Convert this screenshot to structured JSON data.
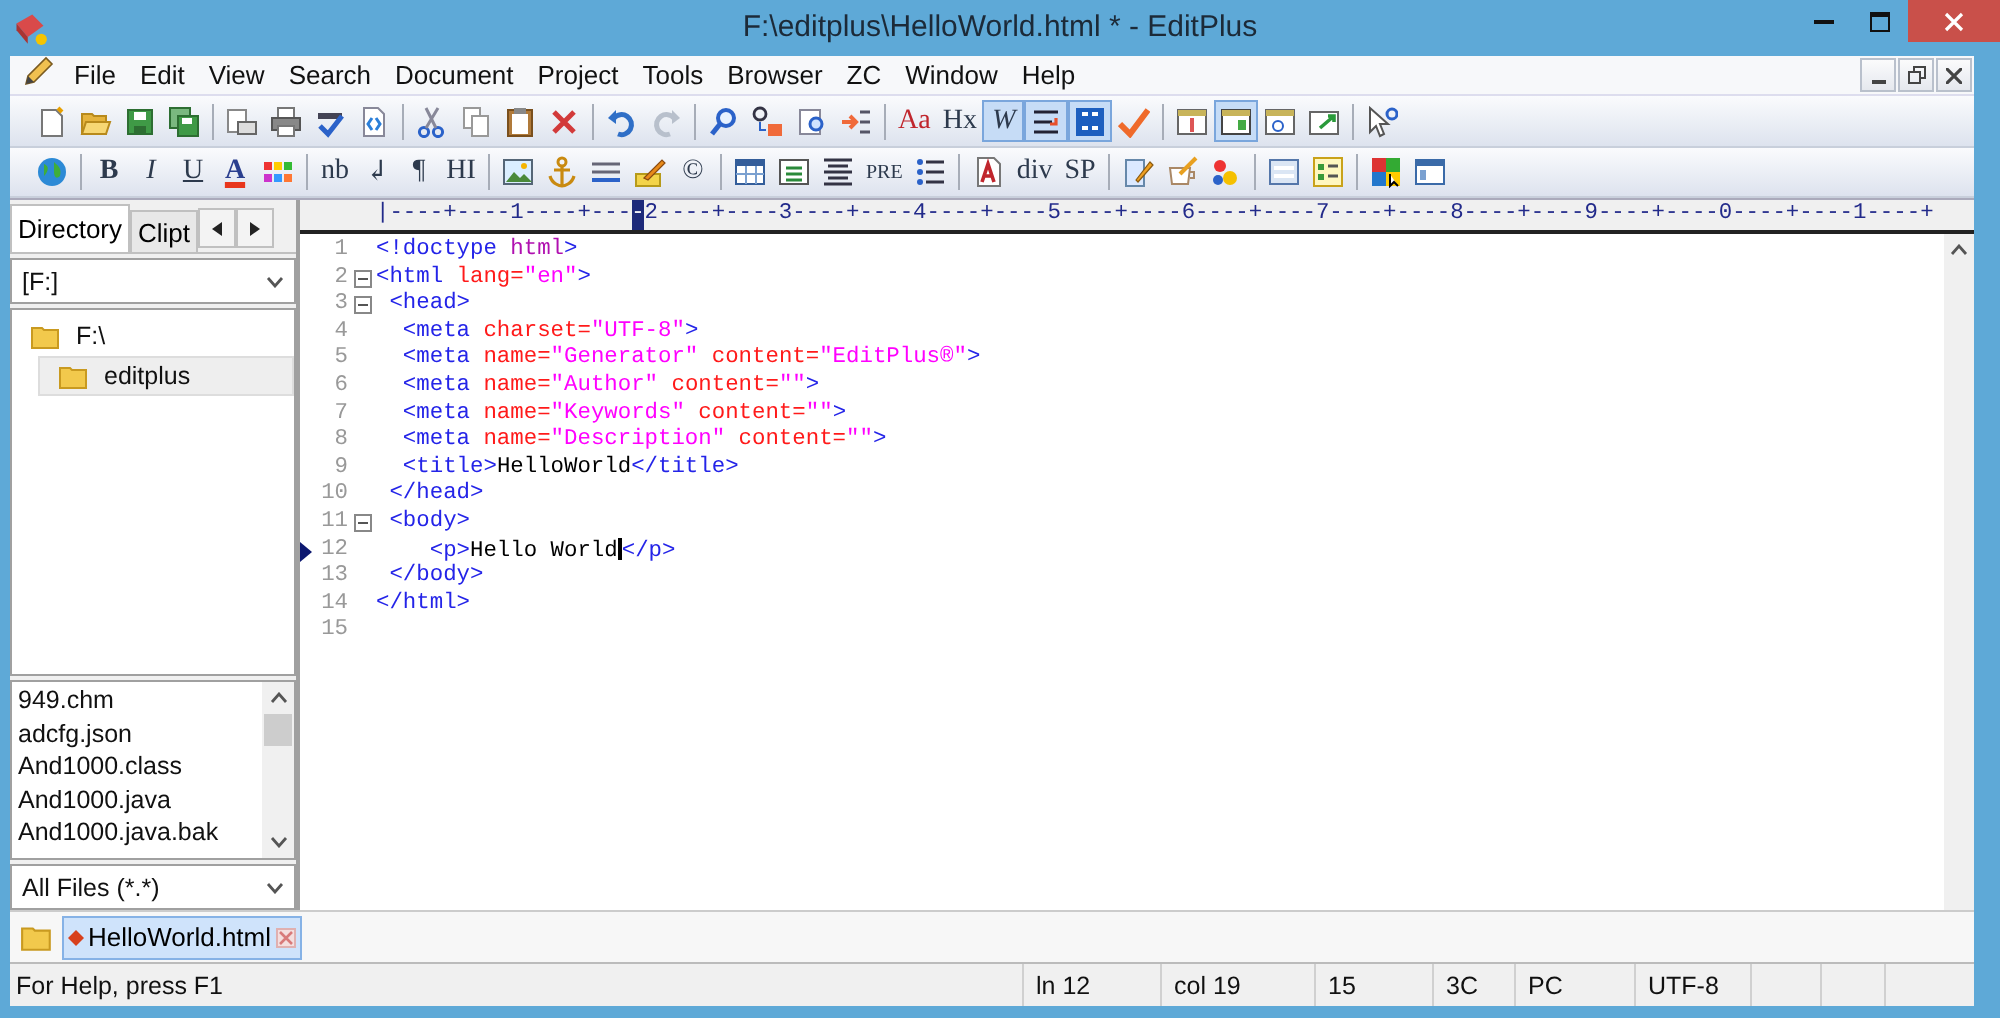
{
  "window": {
    "title": "F:\\editplus\\HelloWorld.html * - EditPlus"
  },
  "menu": [
    "File",
    "Edit",
    "View",
    "Search",
    "Document",
    "Project",
    "Tools",
    "Browser",
    "ZC",
    "Window",
    "Help"
  ],
  "toolbar_1": [
    {
      "kind": "icon",
      "on": false
    },
    {
      "kind": "icon",
      "on": false
    },
    {
      "kind": "icon",
      "on": false
    },
    {
      "kind": "icon",
      "on": false
    },
    {
      "kind": "separator"
    },
    {
      "kind": "icon",
      "on": false
    },
    {
      "kind": "icon",
      "on": false
    },
    {
      "kind": "icon",
      "on": false
    },
    {
      "kind": "icon",
      "on": false
    },
    {
      "kind": "separator"
    },
    {
      "kind": "icon",
      "on": false
    },
    {
      "kind": "icon",
      "on": false
    },
    {
      "kind": "icon",
      "on": false
    },
    {
      "kind": "icon",
      "on": false
    },
    {
      "kind": "separator"
    },
    {
      "kind": "icon",
      "on": false
    },
    {
      "kind": "icon",
      "on": false
    },
    {
      "kind": "separator"
    },
    {
      "kind": "icon",
      "on": false
    },
    {
      "kind": "icon",
      "on": false
    },
    {
      "kind": "icon",
      "on": false
    },
    {
      "kind": "icon",
      "on": false
    },
    {
      "kind": "separator"
    },
    {
      "kind": "text",
      "label": "Aa",
      "on": false
    },
    {
      "kind": "text",
      "label": "Hx",
      "on": false
    },
    {
      "kind": "text",
      "label": "W",
      "on": true
    },
    {
      "kind": "icon",
      "on": true
    },
    {
      "kind": "icon",
      "on": true
    },
    {
      "kind": "icon",
      "on": false
    },
    {
      "kind": "separator"
    },
    {
      "kind": "icon",
      "on": false
    },
    {
      "kind": "icon",
      "on": true
    },
    {
      "kind": "icon",
      "on": false
    },
    {
      "kind": "icon",
      "on": false
    },
    {
      "kind": "separator"
    },
    {
      "kind": "icon",
      "on": false
    }
  ],
  "toolbar_2": [
    {
      "kind": "icon",
      "on": false
    },
    {
      "kind": "separator"
    },
    {
      "kind": "text",
      "label": "B",
      "on": false
    },
    {
      "kind": "text",
      "label": "I",
      "on": false
    },
    {
      "kind": "text",
      "label": "U",
      "on": false
    },
    {
      "kind": "text",
      "label": "A",
      "on": false
    },
    {
      "kind": "icon",
      "on": false
    },
    {
      "kind": "separator"
    },
    {
      "kind": "text",
      "label": "nb",
      "on": false
    },
    {
      "kind": "text",
      "label": "↲",
      "on": false
    },
    {
      "kind": "text",
      "label": "¶",
      "on": false
    },
    {
      "kind": "text",
      "label": "HI",
      "on": false
    },
    {
      "kind": "separator"
    },
    {
      "kind": "icon",
      "on": false
    },
    {
      "kind": "icon",
      "on": false
    },
    {
      "kind": "icon",
      "on": false
    },
    {
      "kind": "icon",
      "on": false
    },
    {
      "kind": "text",
      "label": "©",
      "on": false
    },
    {
      "kind": "separator"
    },
    {
      "kind": "icon",
      "on": false
    },
    {
      "kind": "icon",
      "on": false
    },
    {
      "kind": "icon",
      "on": false
    },
    {
      "kind": "text",
      "label": "PRE",
      "on": false
    },
    {
      "kind": "icon",
      "on": false
    },
    {
      "kind": "separator"
    },
    {
      "kind": "icon",
      "on": false
    },
    {
      "kind": "text",
      "label": "div",
      "on": false
    },
    {
      "kind": "text",
      "label": "SP",
      "on": false
    },
    {
      "kind": "separator"
    },
    {
      "kind": "icon",
      "on": false
    },
    {
      "kind": "icon",
      "on": false
    },
    {
      "kind": "icon",
      "on": false
    },
    {
      "kind": "separator"
    },
    {
      "kind": "icon",
      "on": false
    },
    {
      "kind": "icon",
      "on": false
    },
    {
      "kind": "separator"
    },
    {
      "kind": "icon",
      "on": false
    },
    {
      "kind": "icon",
      "on": false
    }
  ],
  "sidebar": {
    "tabs": [
      {
        "label": "Directory",
        "selected": true
      },
      {
        "label": "Clipt",
        "selected": false
      }
    ],
    "drive": "[F:]",
    "tree": [
      {
        "label": "F:\\",
        "selected": false,
        "children": [
          {
            "label": "editplus",
            "selected": true
          }
        ]
      }
    ],
    "files": [
      "949.chm",
      "adcfg.json",
      "And1000.class",
      "And1000.java",
      "And1000.java.bak"
    ],
    "filter": "All Files (*.*)"
  },
  "editor": {
    "ruler": {
      "before": "|----+----1----+---",
      "cursor": "-",
      "after": "2----+----3----+----4----+----5----+----6----+----7----+----8----+----9----+----0----+----1----+"
    },
    "lines": [
      {
        "number": "1",
        "fold": false,
        "current": false,
        "tokens": [
          {
            "kind": "tag",
            "text": "<!doctype"
          },
          {
            "kind": "doctype",
            "text": " html"
          },
          {
            "kind": "tag",
            "text": ">"
          }
        ]
      },
      {
        "number": "2",
        "fold": true,
        "current": false,
        "tokens": [
          {
            "kind": "tag",
            "text": "<html"
          },
          {
            "kind": "attr",
            "text": " lang="
          },
          {
            "kind": "value",
            "text": "\"en\""
          },
          {
            "kind": "tag",
            "text": ">"
          }
        ]
      },
      {
        "number": "3",
        "fold": true,
        "current": false,
        "tokens": [
          {
            "kind": "tag",
            "text": " <head>"
          }
        ]
      },
      {
        "number": "4",
        "fold": false,
        "current": false,
        "tokens": [
          {
            "kind": "tag",
            "text": "  <meta"
          },
          {
            "kind": "attr",
            "text": " charset="
          },
          {
            "kind": "value",
            "text": "\"UTF-8\""
          },
          {
            "kind": "tag",
            "text": ">"
          }
        ]
      },
      {
        "number": "5",
        "fold": false,
        "current": false,
        "tokens": [
          {
            "kind": "tag",
            "text": "  <meta"
          },
          {
            "kind": "attr",
            "text": " name="
          },
          {
            "kind": "value",
            "text": "\"Generator\""
          },
          {
            "kind": "attr",
            "text": " content="
          },
          {
            "kind": "value",
            "text": "\"EditPlus®\""
          },
          {
            "kind": "tag",
            "text": ">"
          }
        ]
      },
      {
        "number": "6",
        "fold": false,
        "current": false,
        "tokens": [
          {
            "kind": "tag",
            "text": "  <meta"
          },
          {
            "kind": "attr",
            "text": " name="
          },
          {
            "kind": "value",
            "text": "\"Author\""
          },
          {
            "kind": "attr",
            "text": " content="
          },
          {
            "kind": "value",
            "text": "\"\""
          },
          {
            "kind": "tag",
            "text": ">"
          }
        ]
      },
      {
        "number": "7",
        "fold": false,
        "current": false,
        "tokens": [
          {
            "kind": "tag",
            "text": "  <meta"
          },
          {
            "kind": "attr",
            "text": " name="
          },
          {
            "kind": "value",
            "text": "\"Keywords\""
          },
          {
            "kind": "attr",
            "text": " content="
          },
          {
            "kind": "value",
            "text": "\"\""
          },
          {
            "kind": "tag",
            "text": ">"
          }
        ]
      },
      {
        "number": "8",
        "fold": false,
        "current": false,
        "tokens": [
          {
            "kind": "tag",
            "text": "  <meta"
          },
          {
            "kind": "attr",
            "text": " name="
          },
          {
            "kind": "value",
            "text": "\"Description\""
          },
          {
            "kind": "attr",
            "text": " content="
          },
          {
            "kind": "value",
            "text": "\"\""
          },
          {
            "kind": "tag",
            "text": ">"
          }
        ]
      },
      {
        "number": "9",
        "fold": false,
        "current": false,
        "tokens": [
          {
            "kind": "tag",
            "text": "  <title>"
          },
          {
            "kind": "text",
            "text": "HelloWorld"
          },
          {
            "kind": "tag",
            "text": "</title>"
          }
        ]
      },
      {
        "number": "10",
        "fold": false,
        "current": false,
        "tokens": [
          {
            "kind": "tag",
            "text": " </head>"
          }
        ]
      },
      {
        "number": "11",
        "fold": true,
        "current": false,
        "tokens": [
          {
            "kind": "tag",
            "text": " <body>"
          }
        ]
      },
      {
        "number": "12",
        "fold": false,
        "current": true,
        "tokens": [
          {
            "kind": "tag",
            "text": "    <p>"
          },
          {
            "kind": "text",
            "text": "Hello World"
          },
          {
            "kind": "caret"
          },
          {
            "kind": "tag",
            "text": "</p>"
          }
        ]
      },
      {
        "number": "13",
        "fold": false,
        "current": false,
        "tokens": [
          {
            "kind": "tag",
            "text": " </body>"
          }
        ]
      },
      {
        "number": "14",
        "fold": false,
        "current": false,
        "tokens": [
          {
            "kind": "tag",
            "text": "</html>"
          }
        ]
      },
      {
        "number": "15",
        "fold": false,
        "current": false
      }
    ]
  },
  "document_tabs": [
    {
      "label": "HelloWorld.html",
      "modified": true,
      "selected": true
    }
  ],
  "status_bar": {
    "help": "For Help, press F1",
    "cells": [
      "ln 12",
      "col 19",
      "15",
      "3C",
      "PC",
      "UTF-8"
    ]
  }
}
